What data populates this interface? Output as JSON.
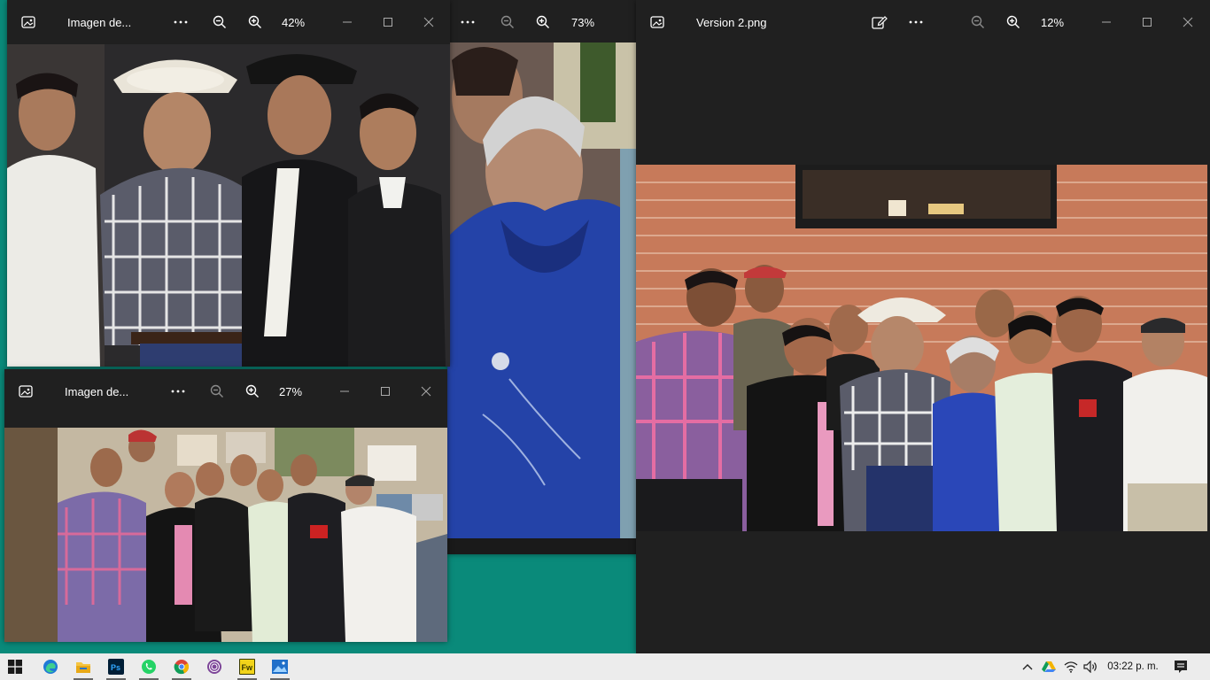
{
  "windows": {
    "w1": {
      "title": "Imagen de...",
      "zoom": "42%"
    },
    "w2": {
      "zoom": "73%"
    },
    "w3": {
      "title": "Imagen de...",
      "zoom": "27%"
    },
    "w4": {
      "title": "Version 2.png",
      "zoom": "12%"
    }
  },
  "icons": {
    "more": "more-options-icon",
    "zoom_out": "zoom-out-icon",
    "zoom_in": "zoom-in-icon",
    "minimize": "minimize-icon",
    "maximize": "maximize-icon",
    "close": "close-icon",
    "photos": "photos-app-icon",
    "edit": "edit-image-icon"
  },
  "taskbar": {
    "clock": "03:22 p. m.",
    "apps": [
      "windows-start",
      "microsoft-edge",
      "file-explorer",
      "photoshop",
      "whatsapp",
      "chrome",
      "tor-browser",
      "fireworks",
      "photos"
    ]
  },
  "colors": {
    "desktop": "#0a8a7a",
    "window_bg": "#202020",
    "taskbar_bg": "#ececec"
  }
}
